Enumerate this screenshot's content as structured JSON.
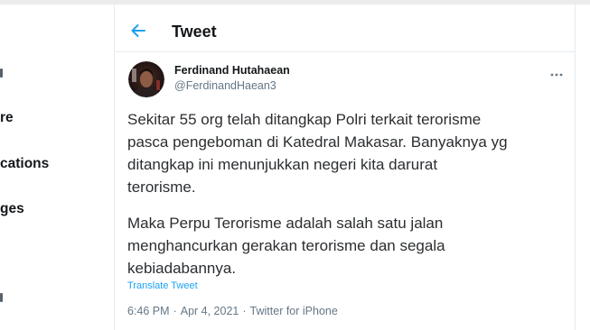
{
  "sidebar": {
    "items": [
      {
        "label": "re"
      },
      {
        "label": "cations"
      },
      {
        "label": "ges"
      }
    ]
  },
  "header": {
    "title": "Tweet",
    "back_icon": "back-arrow-icon"
  },
  "tweet": {
    "author": {
      "name": "Ferdinand Hutahaean",
      "handle": "@FerdinandHaean3",
      "avatar": "profile-photo"
    },
    "more_icon": "more-icon",
    "paragraphs": [
      {
        "lines": [
          "Sekitar 55 org telah ditangkap Polri terkait terorisme",
          "pasca pengeboman di Katedral Makasar. Banyaknya yg",
          "ditangkap ini menunjukkan negeri kita darurat",
          "terorisme."
        ]
      },
      {
        "lines": [
          "Maka Perpu Terorisme adalah salah satu jalan",
          "menghancurkan gerakan terorisme dan segala",
          "kebiadabannya."
        ]
      }
    ],
    "translate_label": "Translate Tweet",
    "meta": {
      "time": "6:46 PM",
      "date": "Apr 4, 2021",
      "source": "Twitter for iPhone",
      "separator": "·"
    }
  },
  "colors": {
    "accent": "#1da1f2",
    "text": "#14171a",
    "secondary": "#657786",
    "border": "#e6ecf0"
  }
}
